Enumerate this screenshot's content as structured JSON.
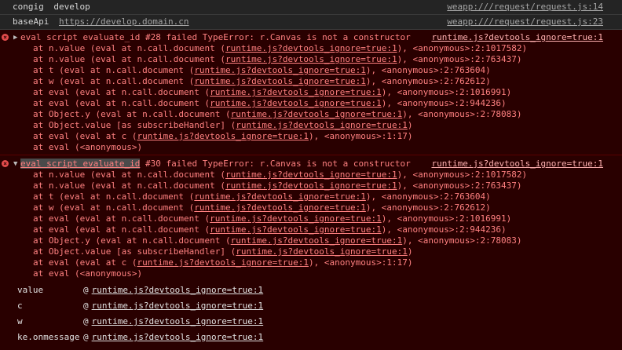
{
  "logs": [
    {
      "label": "congig",
      "value": "develop",
      "value_is_link": false,
      "source": "weapp:///request/request.js:14"
    },
    {
      "label": "baseApi",
      "value": "https://develop.domain.cn",
      "value_is_link": true,
      "source": "weapp:///request/request.js:23"
    }
  ],
  "errors": [
    {
      "prefix": "eval script evaluate_id",
      "message": " #28 failed TypeError: r.Canvas is not a constructor",
      "source": "runtime.js?devtools_ignore=true:1",
      "stack": [
        {
          "pre": "at n.value (eval at n.call.document (",
          "link": "runtime.js?devtools_ignore=true:1",
          "post": "), <anonymous>:2:1017582)"
        },
        {
          "pre": "at n.value (eval at n.call.document (",
          "link": "runtime.js?devtools_ignore=true:1",
          "post": "), <anonymous>:2:763437)"
        },
        {
          "pre": "at t (eval at n.call.document (",
          "link": "runtime.js?devtools_ignore=true:1",
          "post": "), <anonymous>:2:763604)"
        },
        {
          "pre": "at w (eval at n.call.document (",
          "link": "runtime.js?devtools_ignore=true:1",
          "post": "), <anonymous>:2:762612)"
        },
        {
          "pre": "at eval (eval at n.call.document (",
          "link": "runtime.js?devtools_ignore=true:1",
          "post": "), <anonymous>:2:1016991)"
        },
        {
          "pre": "at eval (eval at n.call.document (",
          "link": "runtime.js?devtools_ignore=true:1",
          "post": "), <anonymous>:2:944236)"
        },
        {
          "pre": "at Object.y (eval at n.call.document (",
          "link": "runtime.js?devtools_ignore=true:1",
          "post": "), <anonymous>:2:78083)"
        },
        {
          "pre": "at Object.value [as subscribeHandler] (",
          "link": "runtime.js?devtools_ignore=true:1",
          "post": ")"
        },
        {
          "pre": "at eval (eval at c (",
          "link": "runtime.js?devtools_ignore=true:1",
          "post": "), <anonymous>:1:17)"
        },
        {
          "pre": "at eval (<anonymous>)",
          "link": "",
          "post": ""
        }
      ]
    },
    {
      "prefix": "eval script evaluate_id",
      "message": " #30 failed TypeError: r.Canvas is not a constructor",
      "source": "runtime.js?devtools_ignore=true:1",
      "stack": [
        {
          "pre": "at n.value (eval at n.call.document (",
          "link": "runtime.js?devtools_ignore=true:1",
          "post": "), <anonymous>:2:1017582)"
        },
        {
          "pre": "at n.value (eval at n.call.document (",
          "link": "runtime.js?devtools_ignore=true:1",
          "post": "), <anonymous>:2:763437)"
        },
        {
          "pre": "at t (eval at n.call.document (",
          "link": "runtime.js?devtools_ignore=true:1",
          "post": "), <anonymous>:2:763604)"
        },
        {
          "pre": "at w (eval at n.call.document (",
          "link": "runtime.js?devtools_ignore=true:1",
          "post": "), <anonymous>:2:762612)"
        },
        {
          "pre": "at eval (eval at n.call.document (",
          "link": "runtime.js?devtools_ignore=true:1",
          "post": "), <anonymous>:2:1016991)"
        },
        {
          "pre": "at eval (eval at n.call.document (",
          "link": "runtime.js?devtools_ignore=true:1",
          "post": "), <anonymous>:2:944236)"
        },
        {
          "pre": "at Object.y (eval at n.call.document (",
          "link": "runtime.js?devtools_ignore=true:1",
          "post": "), <anonymous>:2:78083)"
        },
        {
          "pre": "at Object.value [as subscribeHandler] (",
          "link": "runtime.js?devtools_ignore=true:1",
          "post": ")"
        },
        {
          "pre": "at eval (eval at c (",
          "link": "runtime.js?devtools_ignore=true:1",
          "post": "), <anonymous>:1:17)"
        },
        {
          "pre": "at eval (<anonymous>)",
          "link": "",
          "post": ""
        }
      ],
      "props": [
        {
          "name": "value",
          "at": "@",
          "link": "runtime.js?devtools_ignore=true:1"
        },
        {
          "name": "c",
          "at": "@",
          "link": "runtime.js?devtools_ignore=true:1"
        },
        {
          "name": "w",
          "at": "@",
          "link": "runtime.js?devtools_ignore=true:1"
        },
        {
          "name": "ke.onmessage",
          "at": "@",
          "link": "runtime.js?devtools_ignore=true:1"
        }
      ]
    }
  ],
  "icons": {
    "error": "error-circle-icon",
    "collapsed": "caret-right-icon",
    "expanded": "caret-down-icon"
  },
  "colors": {
    "error_text": "#ff8080",
    "error_bg": "#290000",
    "log_bg": "#242424"
  }
}
